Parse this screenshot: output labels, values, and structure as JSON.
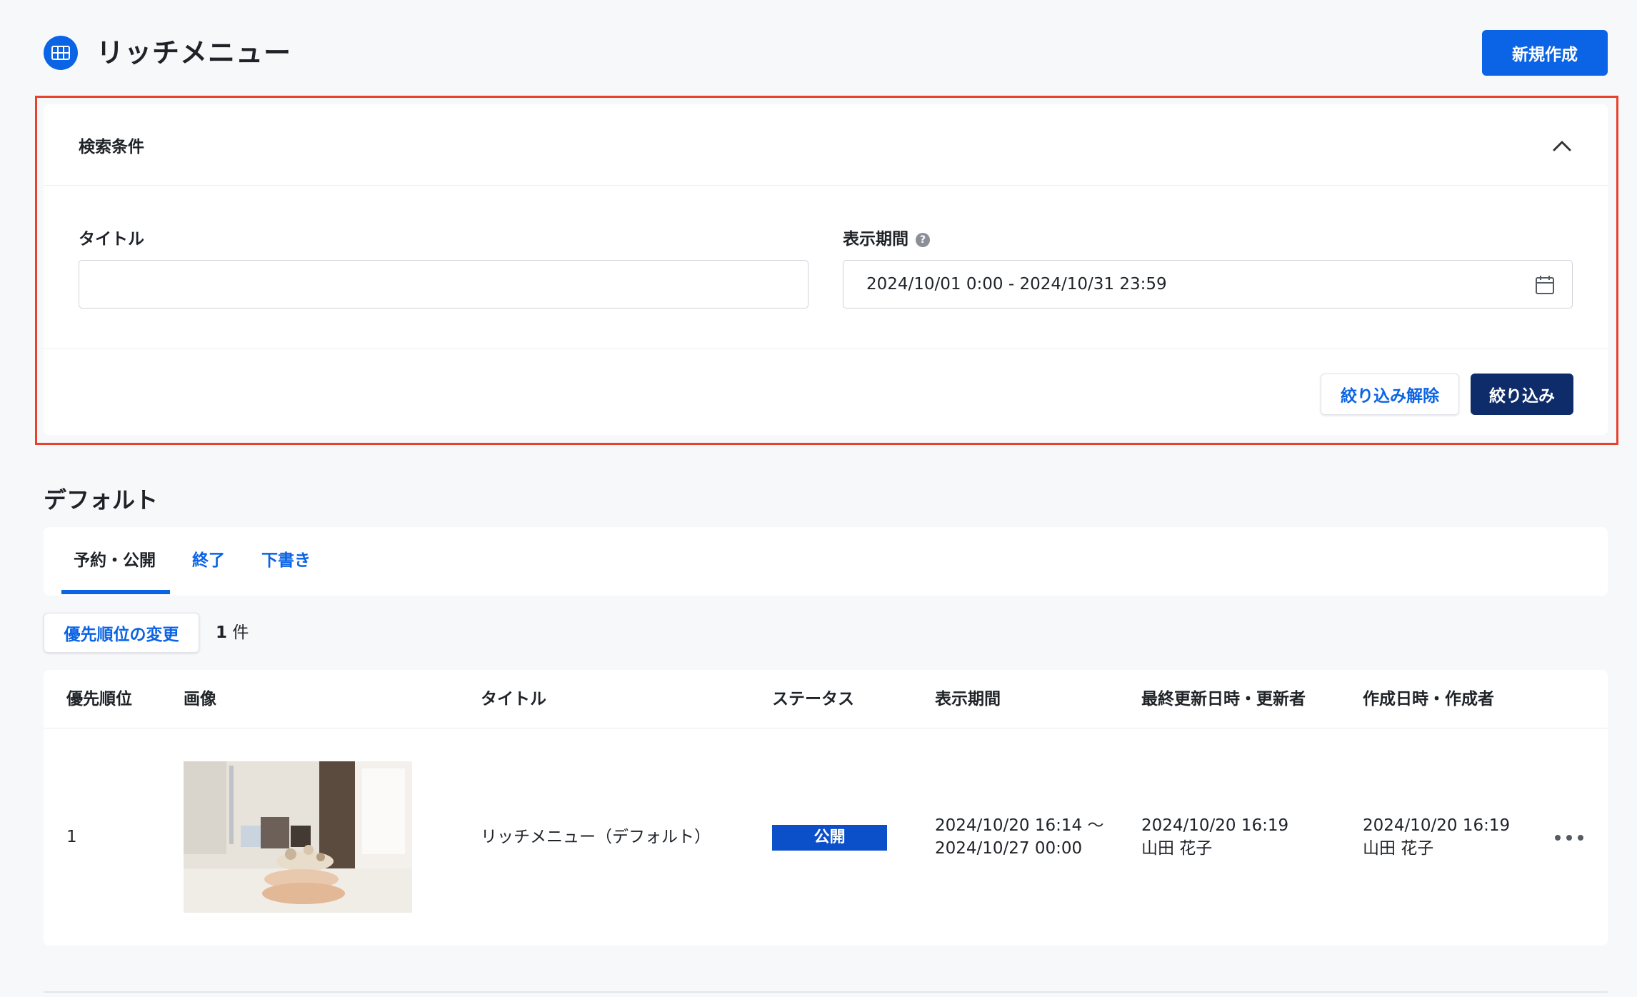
{
  "header": {
    "title": "リッチメニュー",
    "icon": "grid-icon",
    "new_button": "新規作成"
  },
  "search": {
    "heading": "検索条件",
    "title_label": "タイトル",
    "title_value": "",
    "period_label": "表示期間",
    "help_icon": "?",
    "period_value": "2024/10/01 0:00 - 2024/10/31 23:59",
    "clear_button": "絞り込み解除",
    "filter_button": "絞り込み"
  },
  "section": {
    "title": "デフォルト",
    "tabs": [
      {
        "label": "予約・公開"
      },
      {
        "label": "終了"
      },
      {
        "label": "下書き"
      }
    ],
    "priority_button": "優先順位の変更",
    "count_number": "1",
    "count_unit": "件"
  },
  "table": {
    "columns": [
      "優先順位",
      "画像",
      "タイトル",
      "ステータス",
      "表示期間",
      "最終更新日時・更新者",
      "作成日時・作成者"
    ],
    "rows": [
      {
        "priority": "1",
        "title": "リッチメニュー（デフォルト）",
        "status": "公開",
        "period_start": "2024/10/20 16:14 〜",
        "period_end": "2024/10/27 00:00",
        "updated_at": "2024/10/20 16:19",
        "updated_by": "山田 花子",
        "created_at": "2024/10/20 16:19",
        "created_by": "山田 花子"
      }
    ]
  },
  "colors": {
    "primary": "#0b63e5",
    "navy": "#0f2c6a",
    "highlight": "#e8412c",
    "status": "#0b4fc9"
  }
}
